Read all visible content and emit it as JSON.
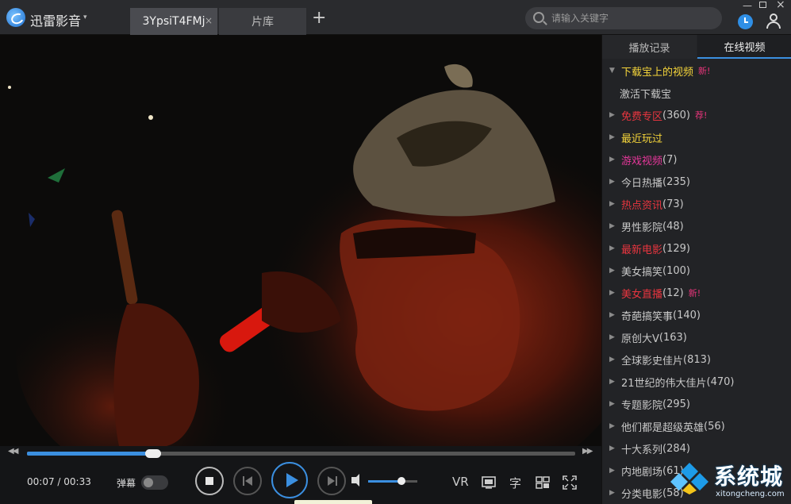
{
  "app": {
    "title": "迅雷影音",
    "caret": "▾"
  },
  "tabs": [
    {
      "label": "3YpsiT4FMj",
      "close": "×"
    },
    {
      "label": "片库"
    }
  ],
  "add_tab": "+",
  "search": {
    "placeholder": "请输入关键字"
  },
  "window": {
    "min": "—",
    "close": "×"
  },
  "player": {
    "current_time": "00:07",
    "total_time": "00:33",
    "time_text": "00:07 / 00:33",
    "progress_fraction": 0.23,
    "volume_fraction": 0.68,
    "danmu_label": "弹幕",
    "danmu_enabled": false,
    "rewind": "◀◀",
    "forward": "▶▶",
    "vr_label": "VR",
    "subtitle_label": "字"
  },
  "sidebar": {
    "tabs": [
      {
        "label": "播放记录"
      },
      {
        "label": "在线视频"
      }
    ],
    "items": [
      {
        "label": "下载宝上的视频",
        "color": "#f4d43a",
        "expanded": true,
        "badge": "新!"
      },
      {
        "label": "激活下载宝",
        "color": "#c8c8c8",
        "child": true
      },
      {
        "label": "免费专区",
        "count": "(360)",
        "color": "#e8353f",
        "badge": "荐!"
      },
      {
        "label": "最近玩过",
        "color": "#f4d43a"
      },
      {
        "label": "游戏视频",
        "count": "(7)",
        "color": "#e5379a"
      },
      {
        "label": "今日热播",
        "count": "(235)",
        "color": "#c8c8c8"
      },
      {
        "label": "热点资讯",
        "count": "(73)",
        "color": "#e8353f"
      },
      {
        "label": "男性影院",
        "count": "(48)",
        "color": "#c8c8c8"
      },
      {
        "label": "最新电影",
        "count": "(129)",
        "color": "#e8353f"
      },
      {
        "label": "美女搞笑",
        "count": "(100)",
        "color": "#c8c8c8"
      },
      {
        "label": "美女直播",
        "count": "(12)",
        "color": "#e8353f",
        "badge": "新!"
      },
      {
        "label": "奇葩搞笑事",
        "count": "(140)",
        "color": "#c8c8c8"
      },
      {
        "label": "原创大V",
        "count": "(163)",
        "color": "#c8c8c8"
      },
      {
        "label": "全球影史佳片",
        "count": "(813)",
        "color": "#c8c8c8"
      },
      {
        "label": "21世纪的伟大佳片",
        "count": "(470)",
        "color": "#c8c8c8"
      },
      {
        "label": "专题影院",
        "count": "(295)",
        "color": "#c8c8c8"
      },
      {
        "label": "他们都是超级英雄",
        "count": "(56)",
        "color": "#c8c8c8"
      },
      {
        "label": "十大系列",
        "count": "(284)",
        "color": "#c8c8c8"
      },
      {
        "label": "内地剧场",
        "count": "(61)",
        "color": "#c8c8c8"
      },
      {
        "label": "分类电影",
        "count": "(58)",
        "color": "#c8c8c8"
      }
    ]
  },
  "watermark": {
    "text": "系统城",
    "url": "xitongcheng.com"
  },
  "colors": {
    "accent": "#3b8fe0",
    "hot": "#e8353f",
    "highlight": "#f4d43a",
    "badge": "#e8357b"
  }
}
